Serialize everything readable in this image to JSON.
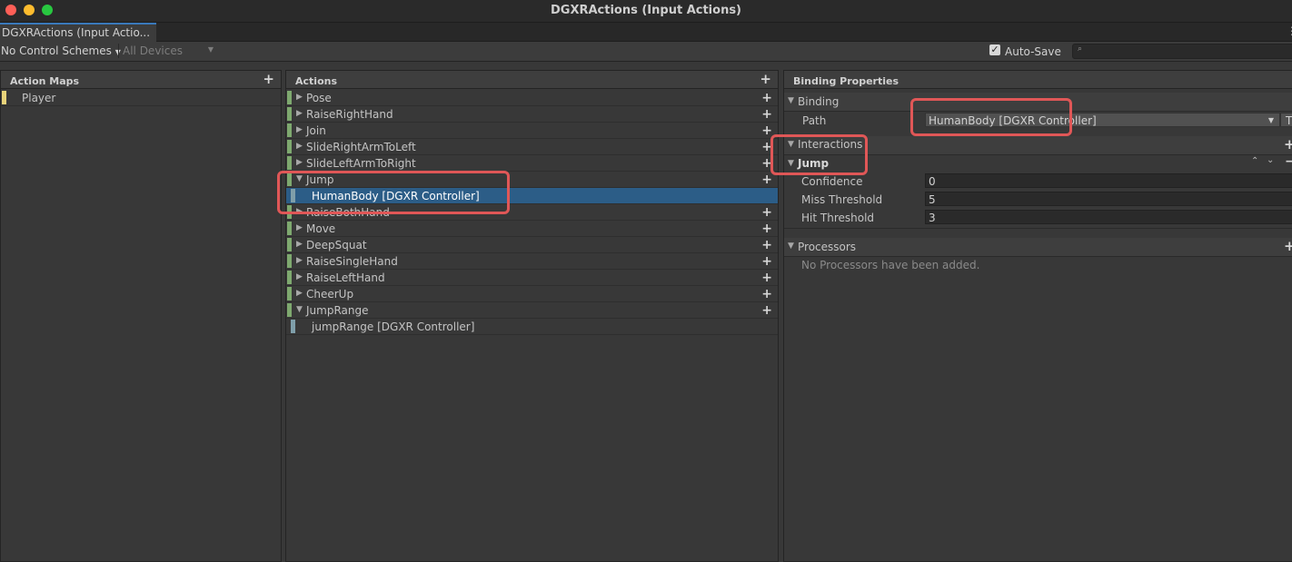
{
  "window": {
    "title": "DGXRActions (Input Actions)",
    "tab_label": "DGXRActions (Input Actio..."
  },
  "toolbar": {
    "control_scheme": "No Control Schemes",
    "devices": "All Devices",
    "auto_save_label": "Auto-Save",
    "auto_save_checked": true
  },
  "action_maps": {
    "header": "Action Maps",
    "items": [
      {
        "label": "Player",
        "selected": true
      }
    ]
  },
  "actions": {
    "header": "Actions",
    "rows": [
      {
        "label": "Pose",
        "kind": "action",
        "expanded": false
      },
      {
        "label": "RaiseRightHand",
        "kind": "action",
        "expanded": false
      },
      {
        "label": "Join",
        "kind": "action",
        "expanded": false
      },
      {
        "label": "SlideRightArmToLeft",
        "kind": "action",
        "expanded": false
      },
      {
        "label": "SlideLeftArmToRight",
        "kind": "action",
        "expanded": false
      },
      {
        "label": "Jump",
        "kind": "action",
        "expanded": true
      },
      {
        "label": "HumanBody [DGXR Controller]",
        "kind": "binding",
        "selected": true
      },
      {
        "label": "RaiseBothHand",
        "kind": "action",
        "expanded": false
      },
      {
        "label": "Move",
        "kind": "action",
        "expanded": false
      },
      {
        "label": "DeepSquat",
        "kind": "action",
        "expanded": false
      },
      {
        "label": "RaiseSingleHand",
        "kind": "action",
        "expanded": false
      },
      {
        "label": "RaiseLeftHand",
        "kind": "action",
        "expanded": false
      },
      {
        "label": "CheerUp",
        "kind": "action",
        "expanded": false
      },
      {
        "label": "JumpRange",
        "kind": "action",
        "expanded": true
      },
      {
        "label": "jumpRange [DGXR Controller]",
        "kind": "binding",
        "selected": false
      }
    ]
  },
  "binding_properties": {
    "header": "Binding Properties",
    "binding_section": "Binding",
    "path_label": "Path",
    "path_value": "HumanBody [DGXR Controller]",
    "path_t_button": "T",
    "interactions_section": "Interactions",
    "interaction_name": "Jump",
    "params": [
      {
        "label": "Confidence",
        "value": "0"
      },
      {
        "label": "Miss Threshold",
        "value": "5"
      },
      {
        "label": "Hit Threshold",
        "value": "3"
      }
    ],
    "processors_section": "Processors",
    "processors_empty": "No Processors have been added."
  },
  "colors": {
    "action_bar": "#7ea96f",
    "binding_bar": "#7f9faa",
    "selection": "#2c5d87",
    "map_bar": "#e8d37a",
    "highlight_box": "#e05757"
  }
}
